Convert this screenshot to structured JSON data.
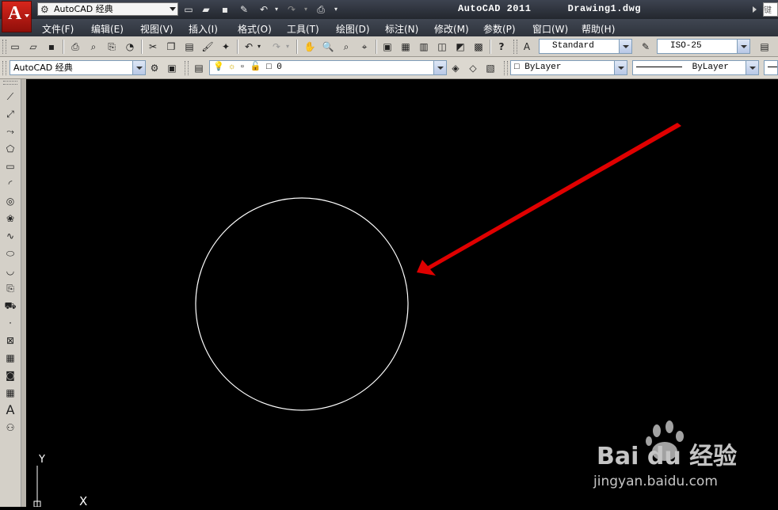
{
  "app": {
    "logo_letter": "A",
    "workspace": "AutoCAD 经典",
    "title": "AutoCAD 2011      Drawing1.dwg",
    "search_placeholder": "键入"
  },
  "menu": [
    "文件(F)",
    "编辑(E)",
    "视图(V)",
    "插入(I)",
    "格式(O)",
    "工具(T)",
    "绘图(D)",
    "标注(N)",
    "修改(M)",
    "参数(P)",
    "窗口(W)",
    "帮助(H)"
  ],
  "toolbar1": {
    "text_style": "Standard",
    "dim_style": "ISO-25"
  },
  "toolbar2": {
    "workspace": "AutoCAD 经典",
    "layer": "0",
    "color": "ByLayer",
    "linetype": "ByLayer"
  },
  "canvas": {
    "background": "#000000",
    "circle_color": "#ffffff",
    "arrow_color": "#e00000",
    "ucs_y_label": "Y",
    "ucs_x_label": "X"
  },
  "watermark": {
    "brand": "Bai du 经验",
    "url": "jingyan.baidu.com"
  }
}
